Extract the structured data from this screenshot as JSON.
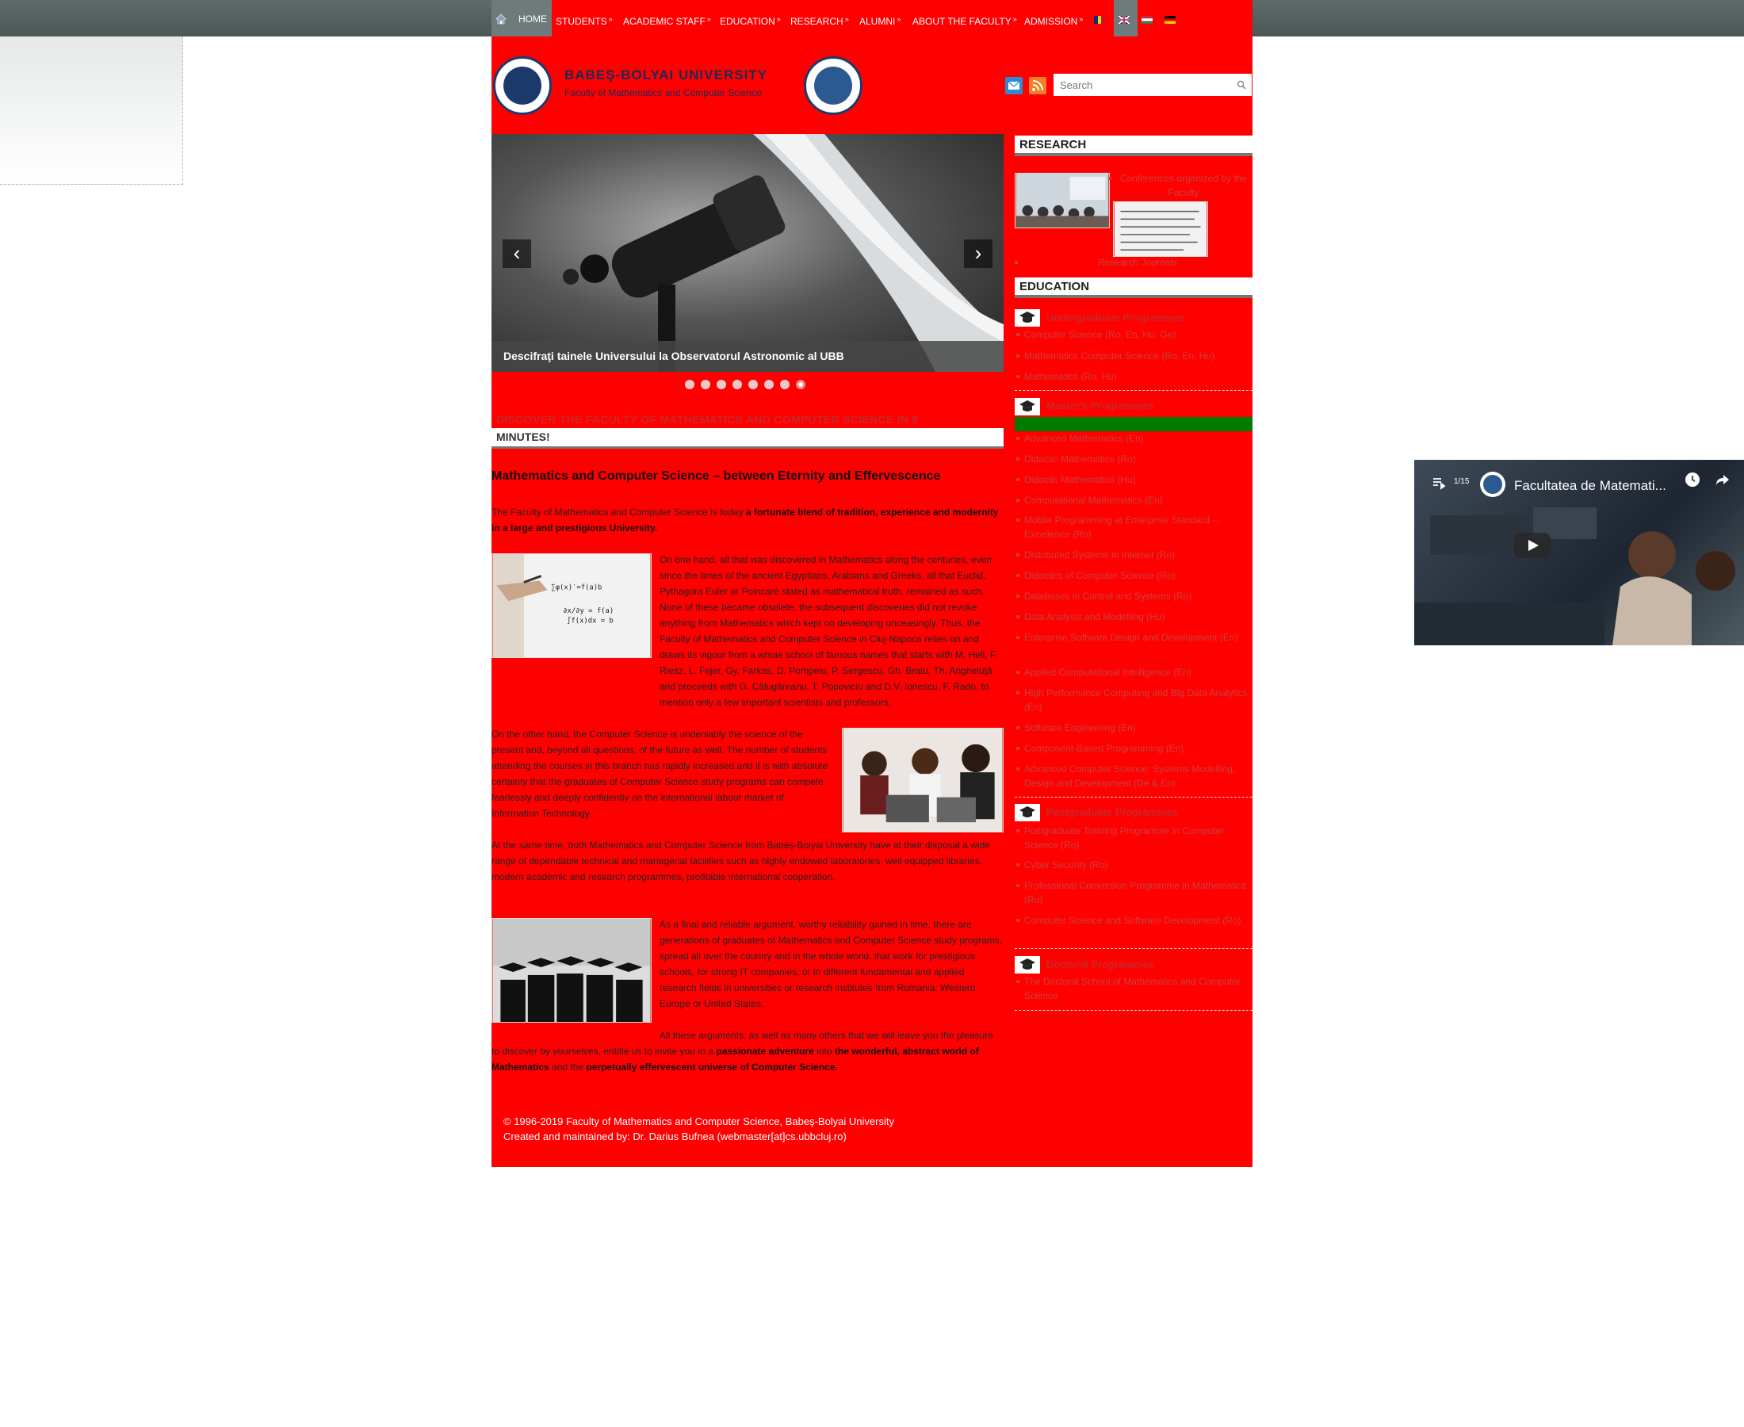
{
  "nav": {
    "items": [
      {
        "label": "HOME"
      },
      {
        "label": "STUDENTS"
      },
      {
        "label": "ACADEMIC STAFF"
      },
      {
        "label": "EDUCATION"
      },
      {
        "label": "RESEARCH"
      },
      {
        "label": "ALUMNI"
      },
      {
        "label": "ABOUT THE FACULTY"
      },
      {
        "label": "ADMISSION"
      }
    ],
    "submenu_marker": "»",
    "languages": [
      "ro-flag-icon",
      "en-flag-icon",
      "hu-flag-icon",
      "de-flag-icon"
    ]
  },
  "header": {
    "university": "BABEŞ-BOLYAI UNIVERSITY",
    "faculty": "Faculty of Mathematics and Computer Science",
    "search_placeholder": "Search",
    "icons": [
      "email-icon",
      "rss-icon",
      "search-icon"
    ]
  },
  "slider": {
    "caption": "Descifraţi tainele Universului la Observatorul Astronomic al UBB",
    "prev": "‹",
    "next": "›",
    "dot_count": 8,
    "active_dot": 8
  },
  "discover": {
    "line1": "DISCOVER THE FACULTY OF MATHEMATICS AND COMPUTER SCIENCE IN 9",
    "line2": "MINUTES!"
  },
  "article": {
    "title": "Mathematics and Computer Science – between Eternity and Effervescence",
    "intro_plain": "The Faculty of Mathematics and Computer Science is today ",
    "intro_bold": "a fortunate blend of tradition, experience and modernity in a large and prestigious University.",
    "p1": "On one hand, all that was discovered in Mathematics along the centuries, even since the times of the ancient Egyptians, Arabians and Greeks, all that Euclid, Pythagora Euler or Poincaré stated as mathematical truth, remained as such. None of these became obsolete, the subsequent discoveries did not revoke anything from Mathematics which kept on developing unceasingly. Thus, the Faculty of Mathematics and Computer Science in Cluj-Napoca relies on and draws its vigour from a whole school of famous names that starts with M. Hell, F. Riesz, L. Fejer, Gy. Farkas, D. Pompeiu, P. Sergescu, Gh. Bratu, Th. Angheluţă and proceeds with G. Călugăreanu, T. Popoviciu and D.V. Ionescu, F. Radó, to mention only a few important scientists and professors.",
    "p2": "On the other hand, the Computer Science is undeniably the science of the present and, beyond all questions, of the future as well. The number of students attending the courses in this branch has rapidly increased and it is with absolute certainty that the graduates of Computer Science study programs can compete fearlessly and deeply confidently on the international labour market of Information Technology.",
    "p3": "At the same time, both Mathematics and Computer Science from Babeş-Bolyai University have at their disposal a wide range of dependable technical and managerial facilities such as highly endowed laboratories, well equipped libraries, modern academic and research programmes, profitable international cooperation.",
    "p4": "As a final and reliable argument, worthy reliability gained in time, there are generations of graduates of Mathematics and Computer Science study programs, spread all over the country and in the whole world, that work for prestigious schools, for strong IT companies, or in different fundamental and applied research fields in universities or research institutes from Romania, Western Europe or United States.",
    "p5_a": "All these arguments, as well as many others that we will leave you the pleasure to discover by yourselves, entitle us to invite you to a ",
    "p5_b": "passionate adventure",
    "p5_c": " into ",
    "p5_d": "the wonderful, abstract world of Mathematics",
    "p5_e": " and the ",
    "p5_f": "perpetually effervescent universe of Computer Science."
  },
  "footer": {
    "line1": "© 1996-2019 Faculty of Mathematics and Computer Science, Babeş-Bolyai University",
    "line2": "Created and maintained by: Dr. Darius Bufnea (webmaster[at]cs.ubbcluj.ro)"
  },
  "sidebar": {
    "research_title": "RESEARCH",
    "research_link1": "Conferences organized by the Faculty",
    "research_link2": "Research Journals",
    "education_title": "EDUCATION",
    "undergrad_title": "Undergraduate Programmes",
    "undergrad": [
      "Computer Science (Ro, En, Hu, Ge)",
      "Mathematics Computer Science (Ro, En, Hu)",
      "Mathematics (Ro, Hu)"
    ],
    "master_title": "Master's Programmes",
    "master": [
      "Advanced Mathematics (En)",
      "Didactic Mathematics (Ro)",
      "Didactic Mathematics (Hu)",
      "Computational Mathematics (En)",
      "Mobile Programming at Enterprise Standard – Excellence (Ro)",
      "Distributed Systems in Internet (Ro)",
      "Didactics of Computer Science (Ro)",
      "Databases in Control and Systems (Ro)",
      "Data Analysis and Modelling (Hu)",
      "Enterprise Software Design and Development (En)",
      "Applied Computational Intelligence (En)",
      "High Performance Computing and Big Data Analytics (En)",
      "Software Engineering (En)",
      "Component-Based Programming (En)",
      "Advanced Computer Science: Systems Modelling, Design and Development (De & En)"
    ],
    "postgrad_title": "Postgraduate Programmes",
    "postgrad": [
      "Postgraduate Training Programme in Computer Science (Ro)",
      "Cyber Security (Ro)",
      "Professional Conversion Programme in Mathematics (Ro)",
      "Computer Science and Software Development (Ro)"
    ],
    "doctoral_title": "Doctoral Programmes",
    "doctoral": [
      "The Doctoral School of Mathematics and Computer Science"
    ]
  },
  "video": {
    "index": "1/15",
    "title": "Facultatea de Matemati...",
    "icons": [
      "playlist-icon",
      "clock-icon",
      "share-icon",
      "play-icon"
    ]
  }
}
